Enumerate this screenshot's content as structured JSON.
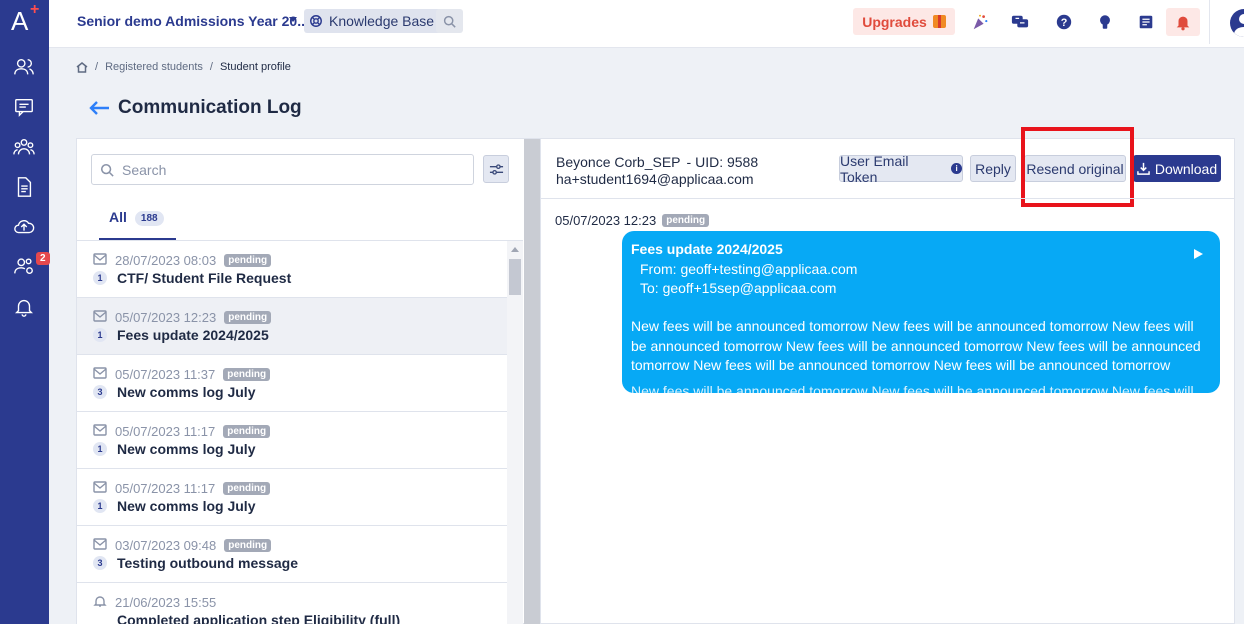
{
  "app": {
    "title": "Senior demo Admissions Year 20...",
    "knowledge_base": "Knowledge Base",
    "upgrades": "Upgrades",
    "brand_color": "#2b3a8f",
    "accent_color": "#07a9f5",
    "alert_color": "#e04b3c"
  },
  "sidebar": {
    "logo": "A",
    "logo_plus": "+",
    "items": [
      {
        "icon": "contacts-icon"
      },
      {
        "icon": "chat-icon"
      },
      {
        "icon": "users-icon"
      },
      {
        "icon": "document-icon"
      },
      {
        "icon": "cloud-upload-icon"
      },
      {
        "icon": "user-settings-icon",
        "badge": "2"
      },
      {
        "icon": "bell-icon"
      }
    ]
  },
  "breadcrumb": {
    "items": [
      "Registered students",
      "Student profile"
    ]
  },
  "page": {
    "title": "Communication Log"
  },
  "list_panel": {
    "search_placeholder": "Search",
    "tab_label": "All",
    "tab_count": "188",
    "rows": [
      {
        "icon": "mail-icon",
        "date": "28/07/2023 08:03",
        "status": "pending",
        "count": "1",
        "subject": "CTF/ Student File Request",
        "selected": false
      },
      {
        "icon": "mail-icon",
        "date": "05/07/2023 12:23",
        "status": "pending",
        "count": "1",
        "subject": "Fees update 2024/2025",
        "selected": true
      },
      {
        "icon": "mail-icon",
        "date": "05/07/2023 11:37",
        "status": "pending",
        "count": "3",
        "subject": "New comms log July",
        "selected": false
      },
      {
        "icon": "mail-icon",
        "date": "05/07/2023 11:17",
        "status": "pending",
        "count": "1",
        "subject": "New comms log July",
        "selected": false
      },
      {
        "icon": "mail-icon",
        "date": "05/07/2023 11:17",
        "status": "pending",
        "count": "1",
        "subject": "New comms log July",
        "selected": false
      },
      {
        "icon": "mail-icon",
        "date": "03/07/2023 09:48",
        "status": "pending",
        "count": "3",
        "subject": "Testing outbound message",
        "selected": false
      },
      {
        "icon": "bell-icon",
        "date": "21/06/2023 15:55",
        "status": "",
        "count": "",
        "subject": "Completed application step Eligibility (full)",
        "selected": false
      }
    ]
  },
  "detail": {
    "name": "Beyonce Corb_SEP",
    "uid": "- UID: 9588",
    "email": "ha+student1694@applicaa.com",
    "buttons": {
      "token": "User Email Token",
      "reply": "Reply",
      "resend": "Resend original",
      "download": "Download"
    },
    "message": {
      "time": "05/07/2023 12:23",
      "status": "pending",
      "subject": "Fees update 2024/2025",
      "from": "From: geoff+testing@applicaa.com",
      "to": "To: geoff+15sep@applicaa.com",
      "body": "New fees will be announced tomorrow New fees will be announced tomorrow New fees will be announced tomorrow New fees will be announced tomorrow New fees will be announced tomorrow New fees will be announced tomorrow New fees will be announced tomorrow",
      "body_overflow": "New fees will be announced tomorrow New fees will be announced tomorrow New fees will be"
    }
  }
}
